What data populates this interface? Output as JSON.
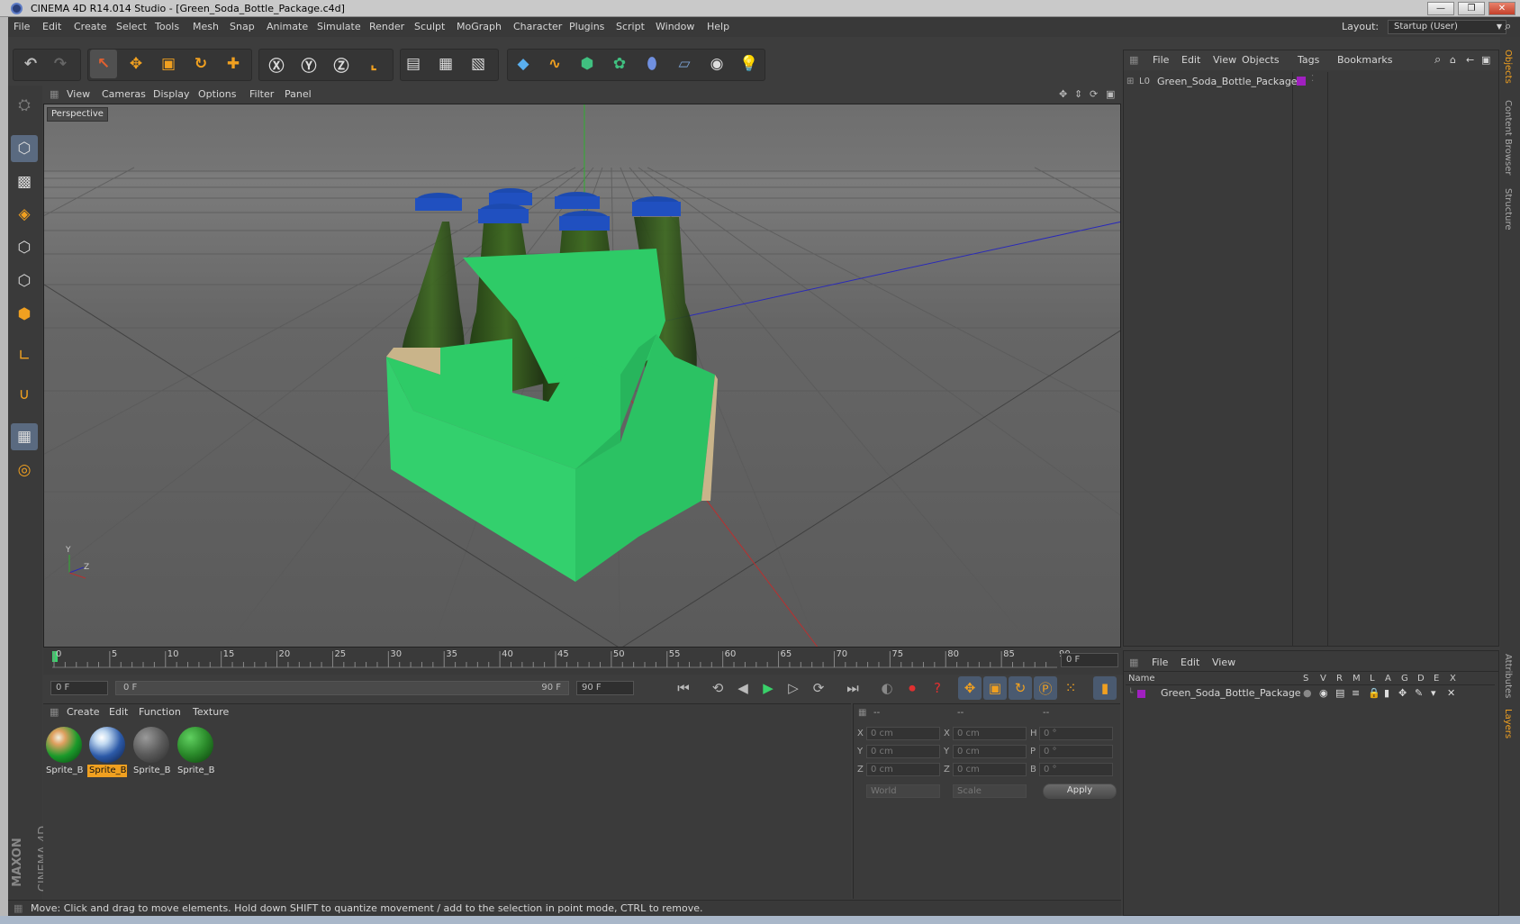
{
  "window": {
    "title": "CINEMA 4D R14.014 Studio - [Green_Soda_Bottle_Package.c4d]",
    "min": "—",
    "max": "❐",
    "close": "✕"
  },
  "menubar": {
    "items": [
      "File",
      "Edit",
      "Create",
      "Select",
      "Tools",
      "Mesh",
      "Snap",
      "Animate",
      "Simulate",
      "Render",
      "Sculpt",
      "MoGraph",
      "Character",
      "Plugins",
      "Script",
      "Window",
      "Help"
    ],
    "layout_label": "Layout:",
    "layout_value": "Startup (User)"
  },
  "viewport": {
    "menu": [
      "View",
      "Cameras",
      "Display",
      "Options",
      "Filter",
      "Panel"
    ],
    "camera_label": "Perspective",
    "axis_y": "Y",
    "axis_z": "Z"
  },
  "timeline": {
    "ticks": [
      "0",
      "5",
      "10",
      "15",
      "20",
      "25",
      "30",
      "35",
      "40",
      "45",
      "50",
      "55",
      "60",
      "65",
      "70",
      "75",
      "80",
      "85",
      "90"
    ],
    "current_frame": "0 F",
    "start_frame": "0 F",
    "range_start": "0 F",
    "range_end": "90 F",
    "end_frame": "90 F"
  },
  "materials": {
    "menu": [
      "Create",
      "Edit",
      "Function",
      "Texture"
    ],
    "items": [
      {
        "label": "Sprite_B",
        "color": "#1a9a2a",
        "selected": false
      },
      {
        "label": "Sprite_B",
        "color": "#2c5aa8",
        "selected": true
      },
      {
        "label": "Sprite_B",
        "color": "#5a5a5a",
        "selected": false
      },
      {
        "label": "Sprite_B",
        "color": "#2a8a2a",
        "selected": false
      }
    ]
  },
  "coordinates": {
    "header": [
      "--",
      "--",
      "--"
    ],
    "rows": [
      {
        "a": "X",
        "av": "0 cm",
        "b": "X",
        "bv": "0 cm",
        "c": "H",
        "cv": "0 °"
      },
      {
        "a": "Y",
        "av": "0 cm",
        "b": "Y",
        "bv": "0 cm",
        "c": "P",
        "cv": "0 °"
      },
      {
        "a": "Z",
        "av": "0 cm",
        "b": "Z",
        "bv": "0 cm",
        "c": "B",
        "cv": "0 °"
      }
    ],
    "mode": "World",
    "scale": "Scale",
    "apply": "Apply"
  },
  "status": "Move: Click and drag to move elements. Hold down SHIFT to quantize movement / add to the selection in point mode, CTRL to remove.",
  "objects_panel": {
    "menu": [
      "File",
      "Edit",
      "View",
      "Objects",
      "Tags",
      "Bookmarks"
    ],
    "object_name": "Green_Soda_Bottle_Package",
    "layer_color": "#a020c0"
  },
  "layers_panel": {
    "menu": [
      "File",
      "Edit",
      "View"
    ],
    "columns": [
      "Name",
      "S",
      "V",
      "R",
      "M",
      "L",
      "A",
      "G",
      "D",
      "E",
      "X"
    ],
    "row_name": "Green_Soda_Bottle_Package"
  },
  "side_tabs": [
    "Objects",
    "Content Browser",
    "Structure",
    "Attributes",
    "Layers"
  ],
  "brand": {
    "line1": "MAXON",
    "line2": "CINEMA 4D"
  }
}
